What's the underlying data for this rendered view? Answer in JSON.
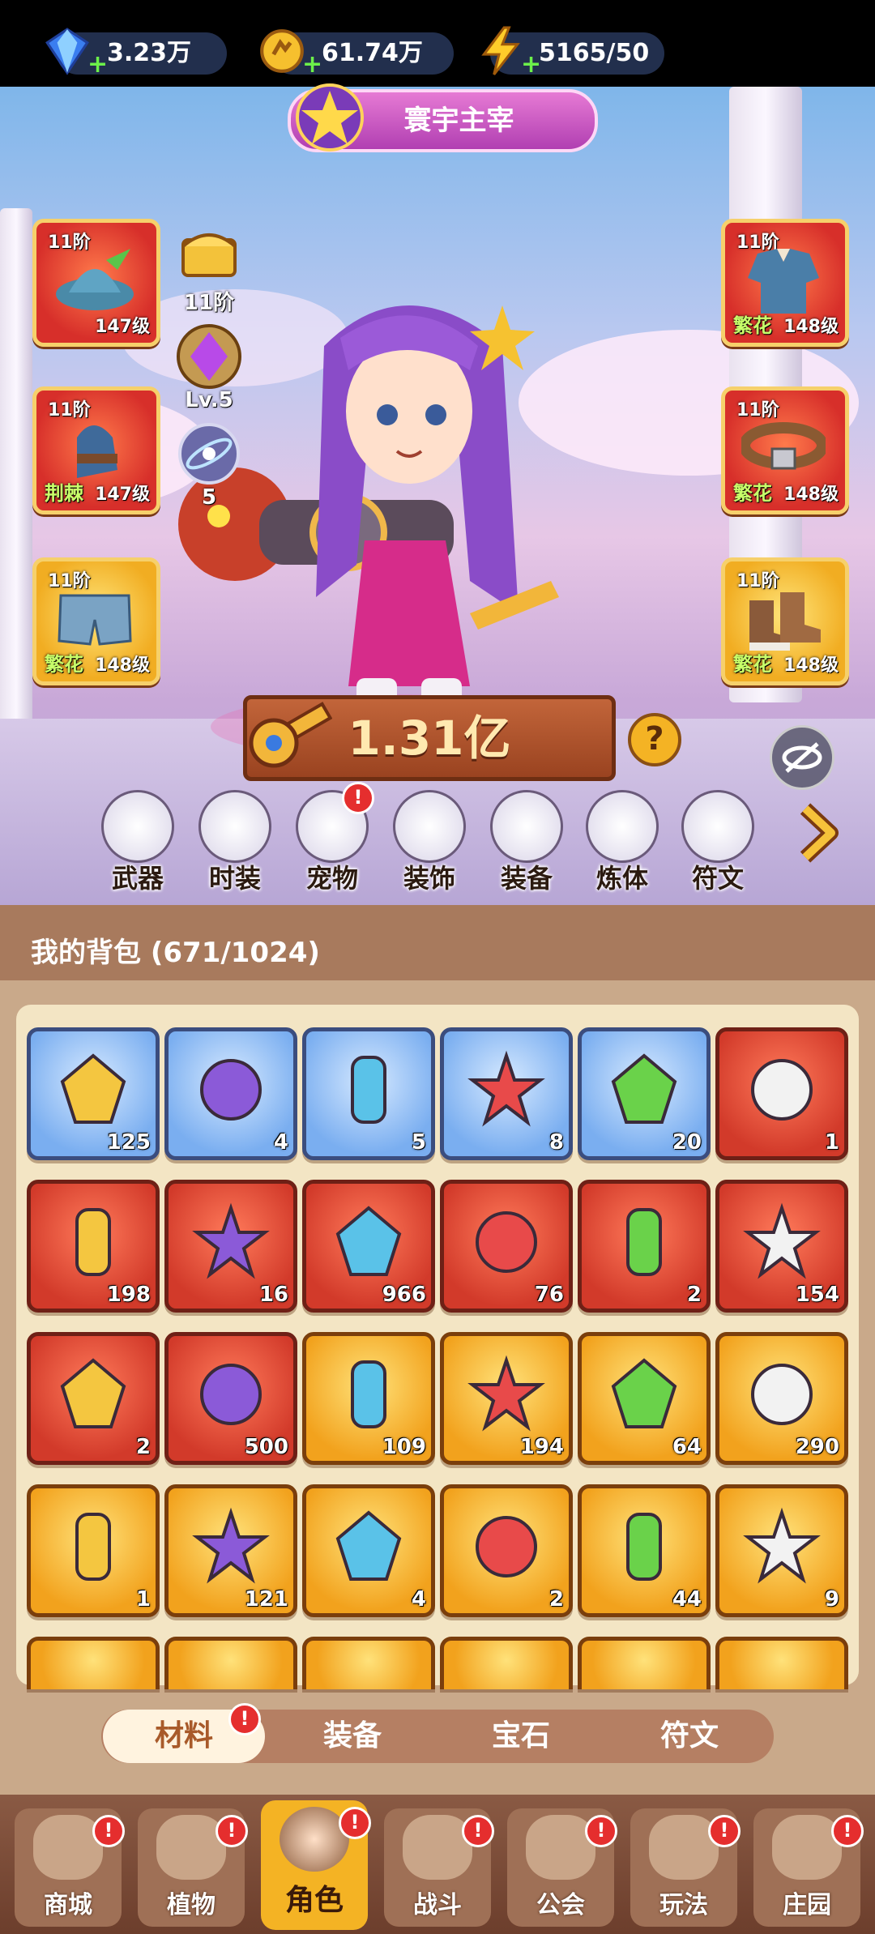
{
  "resources": {
    "diamond": {
      "value": "3.23万",
      "icon": "diamond-icon"
    },
    "coin": {
      "value": "61.74万",
      "icon": "coin-icon"
    },
    "energy": {
      "value": "5165/50",
      "icon": "lightning-icon"
    }
  },
  "title_badge": "寰宇主宰",
  "equipment": {
    "left": [
      {
        "tier": "11阶",
        "level": "147级",
        "tag": "",
        "icon": "hat-icon",
        "color": "red"
      },
      {
        "tier": "11阶",
        "level": "147级",
        "tag": "荆棘",
        "icon": "gloves-icon",
        "color": "red"
      },
      {
        "tier": "11阶",
        "level": "148级",
        "tag": "繁花",
        "icon": "shorts-icon",
        "color": "gold"
      }
    ],
    "right": [
      {
        "tier": "11阶",
        "level": "148级",
        "tag": "繁花",
        "icon": "coat-icon",
        "color": "red"
      },
      {
        "tier": "11阶",
        "level": "148级",
        "tag": "繁花",
        "icon": "belt-icon",
        "color": "red"
      },
      {
        "tier": "11阶",
        "level": "148级",
        "tag": "繁花",
        "icon": "boots-icon",
        "color": "gold"
      }
    ]
  },
  "side_stats": {
    "chest_tier": "11阶",
    "gem_level": "Lv.5",
    "rune_count": "5"
  },
  "power": "1.31亿",
  "help_label": "?",
  "functions": [
    {
      "label": "武器",
      "icon": "weapon-icon",
      "badge": false
    },
    {
      "label": "时装",
      "icon": "outfit-icon",
      "badge": false
    },
    {
      "label": "宠物",
      "icon": "pet-icon",
      "badge": true
    },
    {
      "label": "装饰",
      "icon": "mask-icon",
      "badge": false
    },
    {
      "label": "装备",
      "icon": "armor-icon",
      "badge": false
    },
    {
      "label": "炼体",
      "icon": "body-icon",
      "badge": false
    },
    {
      "label": "符文",
      "icon": "rune-icon",
      "badge": false
    }
  ],
  "bag": {
    "title": "我的背包 (671/1024)",
    "items": [
      {
        "count": "125",
        "color": "blue",
        "icon": "scarab-gem-icon"
      },
      {
        "count": "4",
        "color": "blue",
        "icon": "masquerade-mask-icon"
      },
      {
        "count": "5",
        "color": "blue",
        "icon": "potion-vial-icon"
      },
      {
        "count": "8",
        "color": "blue",
        "icon": "cloud-vial-icon"
      },
      {
        "count": "20",
        "color": "blue",
        "icon": "compass-orb-icon"
      },
      {
        "count": "1",
        "color": "red",
        "icon": "card-watch-icon"
      },
      {
        "count": "198",
        "color": "red",
        "icon": "crystal-star-icon"
      },
      {
        "count": "16",
        "color": "red",
        "icon": "moon-star-icon"
      },
      {
        "count": "966",
        "color": "red",
        "icon": "red-potion-icon"
      },
      {
        "count": "76",
        "color": "red",
        "icon": "green-tube-icon"
      },
      {
        "count": "2",
        "color": "red",
        "icon": "green-capsule-icon"
      },
      {
        "count": "154",
        "color": "red",
        "icon": "hexagram-icon"
      },
      {
        "count": "2",
        "color": "red",
        "icon": "scissors-icon"
      },
      {
        "count": "500",
        "color": "red",
        "icon": "blue-cubes-icon"
      },
      {
        "count": "109",
        "color": "gold",
        "icon": "skull-scroll-icon"
      },
      {
        "count": "194",
        "color": "gold",
        "icon": "basket-icon"
      },
      {
        "count": "64",
        "color": "gold",
        "icon": "ruby-key-icon"
      },
      {
        "count": "290",
        "color": "gold",
        "icon": "golden-key-icon"
      },
      {
        "count": "1",
        "color": "gold",
        "icon": "emerald-key-icon"
      },
      {
        "count": "121",
        "color": "gold",
        "icon": "prism-icon"
      },
      {
        "count": "4",
        "color": "gold",
        "icon": "star-seal-icon"
      },
      {
        "count": "2",
        "color": "gold",
        "icon": "mushroom-icon"
      },
      {
        "count": "44",
        "color": "gold",
        "icon": "spellbook-icon"
      },
      {
        "count": "9",
        "color": "gold",
        "icon": "gold-flower-icon"
      }
    ]
  },
  "tabs": [
    {
      "label": "材料",
      "active": true,
      "badge": true
    },
    {
      "label": "装备",
      "active": false,
      "badge": false
    },
    {
      "label": "宝石",
      "active": false,
      "badge": false
    },
    {
      "label": "符文",
      "active": false,
      "badge": false
    }
  ],
  "nav": [
    {
      "label": "商城",
      "icon": "shop-icon",
      "badge": true,
      "active": false
    },
    {
      "label": "植物",
      "icon": "plant-icon",
      "badge": true,
      "active": false
    },
    {
      "label": "角色",
      "icon": "hero-icon",
      "badge": true,
      "active": true
    },
    {
      "label": "战斗",
      "icon": "battle-icon",
      "badge": true,
      "active": false
    },
    {
      "label": "公会",
      "icon": "guild-icon",
      "badge": true,
      "active": false
    },
    {
      "label": "玩法",
      "icon": "gameplay-icon",
      "badge": true,
      "active": false
    },
    {
      "label": "庄园",
      "icon": "manor-icon",
      "badge": true,
      "active": false
    }
  ],
  "badge_mark": "!"
}
